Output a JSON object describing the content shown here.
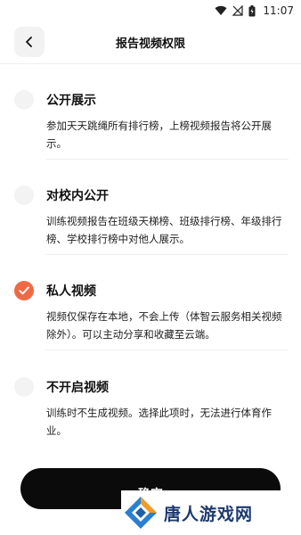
{
  "status_bar": {
    "time": "11:07",
    "icons": [
      "wifi-icon",
      "no-signal-icon",
      "battery-icon"
    ]
  },
  "header": {
    "back_icon": "chevron-left-icon",
    "title": "报告视频权限"
  },
  "options": [
    {
      "title": "公开展示",
      "description": "参加天天跳绳所有排行榜，上榜视频报告将公开展示。",
      "selected": false
    },
    {
      "title": "对校内公开",
      "description": "训练视频报告在班级天梯榜、班级排行榜、年级排行榜、学校排行榜中对他人展示。",
      "selected": false
    },
    {
      "title": "私人视频",
      "description": "视频仅保存在本地，不会上传（体智云服务相关视频除外）。可以主动分享和收藏至云端。",
      "selected": true
    },
    {
      "title": "不开启视频",
      "description": "训练时不生成视频。选择此项时，无法进行体育作业。",
      "selected": false
    }
  ],
  "confirm_button": {
    "label": "确定"
  },
  "watermark": {
    "text": "唐人游戏网"
  },
  "colors": {
    "accent": "#ee6a45",
    "button_bg": "#0b0b0b",
    "watermark_text": "#1d3a6e"
  }
}
